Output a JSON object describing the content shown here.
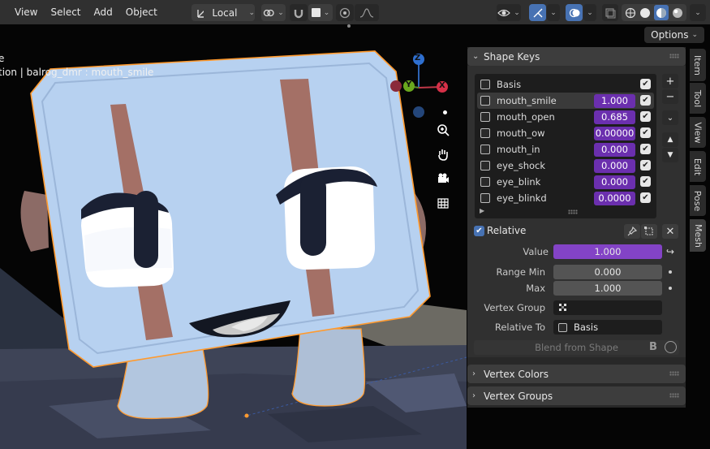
{
  "header": {
    "menus": [
      "View",
      "Select",
      "Add",
      "Object"
    ],
    "orientation": "Local"
  },
  "viewport": {
    "mode_fragment": "e",
    "status_text": "tion | balrog_dmr : mouth_smile",
    "options_label": "Options",
    "gizmo": {
      "z": "Z",
      "y": "Y",
      "x": "X"
    }
  },
  "tabs": [
    "Item",
    "Tool",
    "View",
    "Edit",
    "Pose",
    "Mesh"
  ],
  "shape_keys": {
    "title": "Shape Keys",
    "keys": [
      {
        "name": "Basis",
        "value": null
      },
      {
        "name": "mouth_smile",
        "value": "1.000"
      },
      {
        "name": "mouth_open",
        "value": "0.685"
      },
      {
        "name": "mouth_ow",
        "value": "0.00000"
      },
      {
        "name": "mouth_in",
        "value": "0.000"
      },
      {
        "name": "eye_shock",
        "value": "0.000"
      },
      {
        "name": "eye_blink",
        "value": "0.000"
      },
      {
        "name": "eye_blinkd",
        "value": "0.0000"
      }
    ],
    "relative_label": "Relative",
    "value_label": "Value",
    "value": "1.000",
    "range_min_label": "Range Min",
    "range_min": "0.000",
    "max_label": "Max",
    "max": "1.000",
    "vertex_group_label": "Vertex Group",
    "relative_to_label": "Relative To",
    "relative_to": "Basis",
    "blend_label": "Blend from Shape"
  },
  "sections": {
    "vertex_colors": "Vertex Colors",
    "vertex_groups": "Vertex Groups"
  },
  "colors": {
    "accent_blue": "#4772b3",
    "value_purple": "#8343c6",
    "character_blue": "#b7d1f0",
    "selection_orange": "#ff9a2e"
  }
}
